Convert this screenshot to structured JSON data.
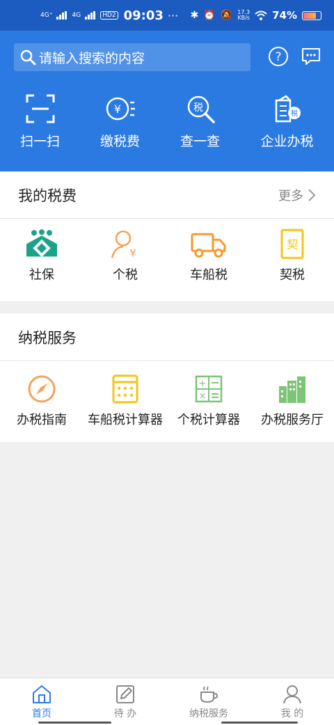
{
  "status": {
    "net1": "4G⁺",
    "net2": "4G",
    "hd": "HD2",
    "time": "09:03",
    "dots": "···",
    "speed_top": "17.3",
    "speed_bottom": "KB/s",
    "battery": "74%",
    "battery_level": 0.74
  },
  "header": {
    "search_placeholder": "请输入搜索的内容",
    "quick": [
      {
        "label": "扫一扫",
        "icon": "scan-icon"
      },
      {
        "label": "缴税费",
        "icon": "pay-tax-icon"
      },
      {
        "label": "查一查",
        "icon": "tax-search-icon"
      },
      {
        "label": "企业办税",
        "icon": "enterprise-icon"
      }
    ]
  },
  "my_tax": {
    "title": "我的税费",
    "more": "更多",
    "items": [
      {
        "label": "社保",
        "icon": "social-security-icon"
      },
      {
        "label": "个税",
        "icon": "personal-tax-icon"
      },
      {
        "label": "车船税",
        "icon": "truck-icon"
      },
      {
        "label": "契税",
        "icon": "deed-tax-icon"
      }
    ],
    "deed_glyph": "契"
  },
  "services": {
    "title": "纳税服务",
    "items": [
      {
        "label": "办税指南",
        "icon": "compass-icon"
      },
      {
        "label": "车船税计算器",
        "icon": "calculator-icon"
      },
      {
        "label": "个税计算器",
        "icon": "tax-calculator-icon"
      },
      {
        "label": "办税服务厅",
        "icon": "buildings-icon"
      }
    ]
  },
  "nav": [
    {
      "label": "首页",
      "icon": "home-icon"
    },
    {
      "label": "待 办",
      "icon": "edit-icon"
    },
    {
      "label": "纳税服务",
      "icon": "coffee-icon"
    },
    {
      "label": "我 的",
      "icon": "user-icon"
    }
  ],
  "colors": {
    "primary": "#2a7ae2",
    "status_bar": "#1c5bbf",
    "teal": "#1aa38a",
    "orange": "#f59a2b",
    "yellow": "#f5c518",
    "green": "#7cc576"
  }
}
